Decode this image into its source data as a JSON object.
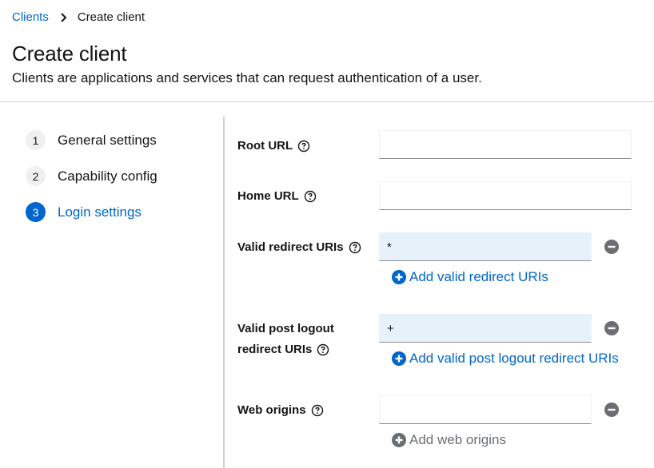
{
  "breadcrumb": {
    "parent": "Clients",
    "current": "Create client"
  },
  "header": {
    "title": "Create client",
    "subtitle": "Clients are applications and services that can request authentication of a user."
  },
  "steps": [
    {
      "number": "1",
      "label": "General settings",
      "active": false
    },
    {
      "number": "2",
      "label": "Capability config",
      "active": false
    },
    {
      "number": "3",
      "label": "Login settings",
      "active": true
    }
  ],
  "form": {
    "root_url": {
      "label": "Root URL",
      "value": ""
    },
    "home_url": {
      "label": "Home URL",
      "value": ""
    },
    "valid_redirect_uris": {
      "label": "Valid redirect URIs",
      "value": "*",
      "add_label": "Add valid redirect URIs"
    },
    "valid_post_logout": {
      "label_line1": "Valid post logout",
      "label_line2": "redirect URIs",
      "value": "+",
      "add_label": "Add valid post logout redirect URIs"
    },
    "web_origins": {
      "label": "Web origins",
      "value": "",
      "add_label": "Add web origins"
    }
  },
  "colors": {
    "accent": "#06c",
    "muted": "#6a6e73",
    "filled_input": "#e7f1fa"
  },
  "icons": [
    "chevron-right-icon",
    "help-icon",
    "minus-circle-icon",
    "plus-circle-icon"
  ]
}
